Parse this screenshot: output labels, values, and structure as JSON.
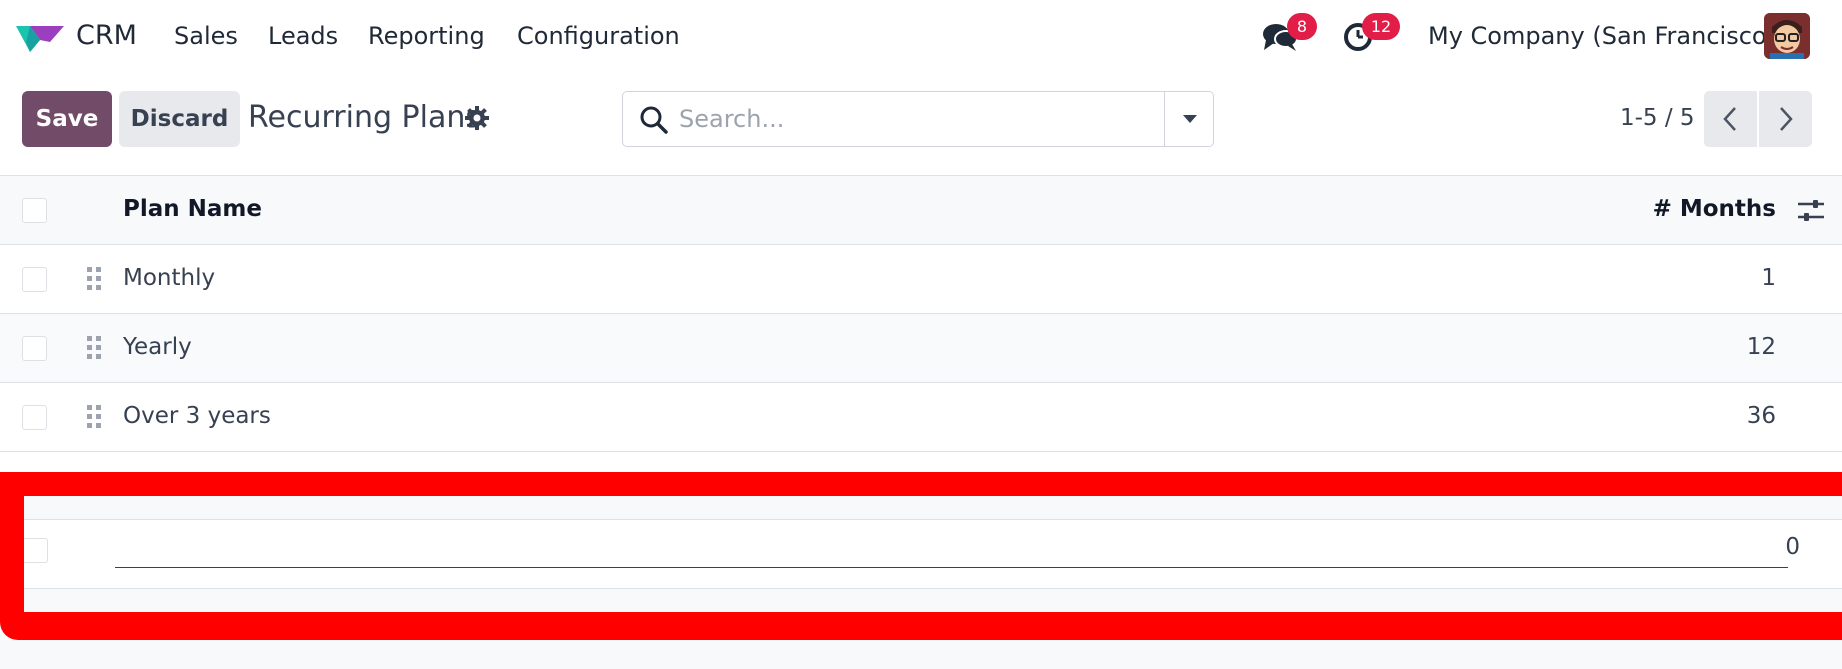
{
  "navbar": {
    "app_name": "CRM",
    "menu": [
      "Sales",
      "Leads",
      "Reporting",
      "Configuration"
    ],
    "messages_count": "8",
    "activities_count": "12",
    "company": "My Company (San Francisco)"
  },
  "control_panel": {
    "save_label": "Save",
    "discard_label": "Discard",
    "title": "Recurring Plans",
    "search_placeholder": "Search...",
    "pager_value": "1-5 / 5"
  },
  "list": {
    "columns": {
      "name": "Plan Name",
      "months": "# Months"
    },
    "rows": [
      {
        "name": "Monthly",
        "months": "1"
      },
      {
        "name": "Yearly",
        "months": "12"
      },
      {
        "name": "Over 3 years",
        "months": "36"
      }
    ],
    "new_row": {
      "name": "",
      "months": "0"
    }
  },
  "colors": {
    "brand": "#714b67",
    "badge": "#e11d48",
    "highlight": "#ff0000"
  },
  "icons": [
    "crm-logo-icon",
    "chat-icon",
    "clock-icon",
    "gear-icon",
    "search-icon",
    "caret-down-icon",
    "chevron-left-icon",
    "chevron-right-icon",
    "drag-handle-icon",
    "optional-columns-icon"
  ]
}
